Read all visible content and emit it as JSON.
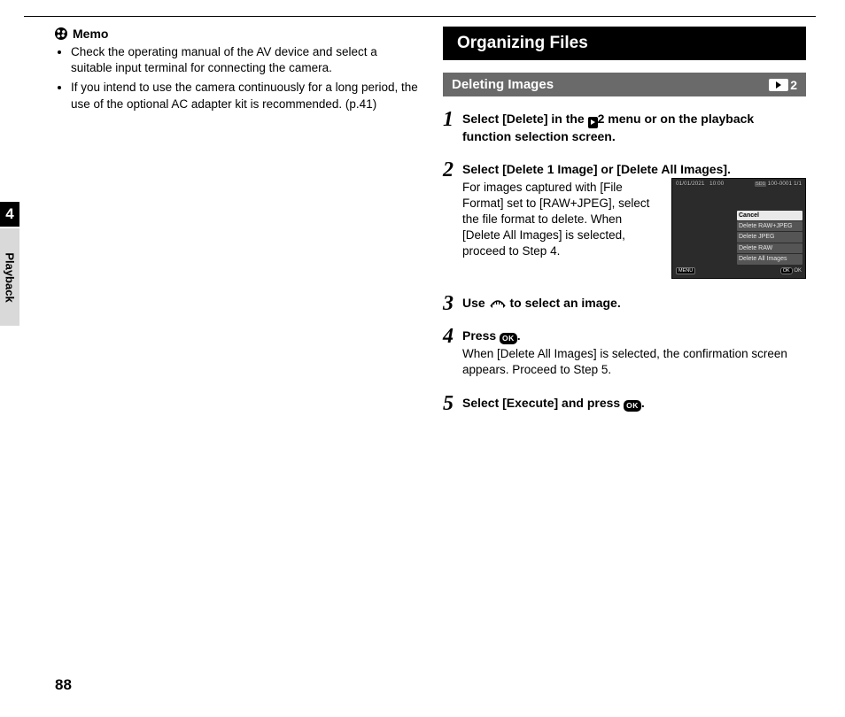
{
  "page_number": "88",
  "chapter_number": "4",
  "side_label": "Playback",
  "memo": {
    "heading": "Memo",
    "items": [
      "Check the operating manual of the AV device and select a suitable input terminal for connecting the camera.",
      "If you intend to use the camera continuously for a long period, the use of the optional AC adapter kit is recommended. (p.41)"
    ]
  },
  "section_title": "Organizing Files",
  "subsection": {
    "title": "Deleting Images",
    "badge_menu_number": "2"
  },
  "steps": {
    "s1_lead_a": "Select [Delete] in the ",
    "s1_lead_b": "2 menu or on the playback function selection screen.",
    "s2_lead": "Select [Delete 1 Image] or [Delete All Images].",
    "s2_body": "For images captured with [File Format] set to [RAW+JPEG], select the file format to delete. When [Delete All Images] is selected, proceed to Step 4.",
    "s3_lead_a": "Use ",
    "s3_lead_b": " to select an image.",
    "s4_lead_a": "Press ",
    "s4_lead_b": ".",
    "s4_body": "When [Delete All Images] is selected, the confirmation screen appears. Proceed to Step 5.",
    "s5_lead_a": "Select [Execute] and press ",
    "s5_lead_b": "."
  },
  "lcd": {
    "date": "01/01/2021",
    "time": "10:00",
    "file_id": "100-0001",
    "count": "1/1",
    "menu_items": [
      "Cancel",
      "Delete RAW+JPEG",
      "Delete JPEG",
      "Delete RAW",
      "Delete All Images"
    ],
    "sd_label": "SD1",
    "menu_pill": "MENU",
    "ok_pill": "OK",
    "ok_hint": "OK"
  },
  "glyphs": {
    "ok_label": "OK"
  }
}
